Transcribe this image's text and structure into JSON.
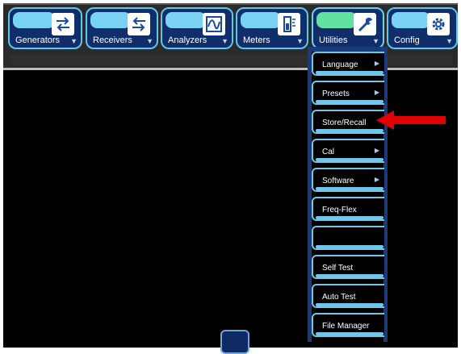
{
  "toolbar": {
    "buttons": [
      {
        "label": "Generators",
        "icon": "generators-icon"
      },
      {
        "label": "Receivers",
        "icon": "receivers-icon"
      },
      {
        "label": "Analyzers",
        "icon": "analyzers-icon"
      },
      {
        "label": "Meters",
        "icon": "meters-icon"
      },
      {
        "label": "Utilities",
        "icon": "wrench-icon"
      },
      {
        "label": "Config",
        "icon": "gear-icon"
      }
    ]
  },
  "utilities_menu": {
    "items": [
      {
        "label": "Language",
        "submenu": true
      },
      {
        "label": "Presets",
        "submenu": true
      },
      {
        "label": "Store/Recall",
        "submenu": false
      },
      {
        "label": "Cal",
        "submenu": true
      },
      {
        "label": "Software",
        "submenu": true
      },
      {
        "label": "Freq-Flex",
        "submenu": false
      },
      {
        "label": "",
        "submenu": false
      },
      {
        "label": "Self Test",
        "submenu": false
      },
      {
        "label": "Auto Test",
        "submenu": false
      },
      {
        "label": "File Manager",
        "submenu": false
      }
    ]
  },
  "colors": {
    "tile_bg": "#0f2e6a",
    "tile_cap": "#7ad3f5",
    "menu_border": "#6fc8ea",
    "highlight_arrow": "#e00000"
  }
}
